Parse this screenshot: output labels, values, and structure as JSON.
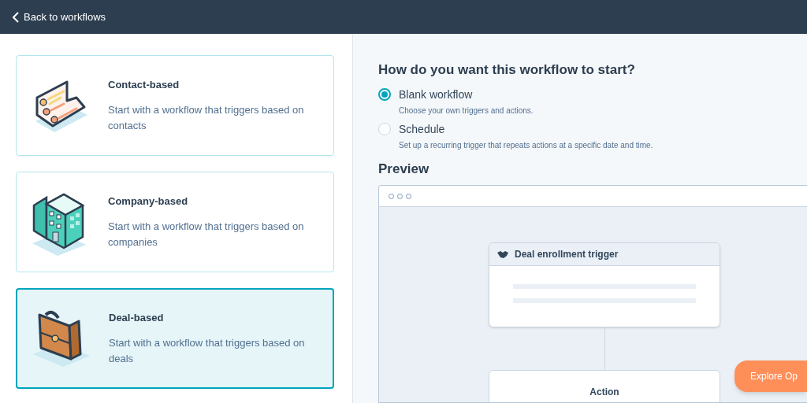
{
  "top_bar": {
    "back_link": "Back to workflows"
  },
  "types": [
    {
      "kind": "contact",
      "title": "Contact-based",
      "description": "Start with a workflow that triggers based on contacts",
      "selected": false
    },
    {
      "kind": "company",
      "title": "Company-based",
      "description": "Start with a workflow that triggers based on companies",
      "selected": false
    },
    {
      "kind": "deal",
      "title": "Deal-based",
      "description": "Start with a workflow that triggers based on deals",
      "selected": true
    }
  ],
  "start": {
    "heading": "How do you want this workflow to start?",
    "options": [
      {
        "label": "Blank workflow",
        "hint": "Choose your own triggers and actions.",
        "selected": true
      },
      {
        "label": "Schedule",
        "hint": "Set up a recurring trigger that repeats actions at a specific date and time.",
        "selected": false
      }
    ]
  },
  "preview": {
    "heading": "Preview",
    "trigger_title": "Deal enrollment trigger",
    "action_title": "Action"
  },
  "floating_button": "Explore Op"
}
